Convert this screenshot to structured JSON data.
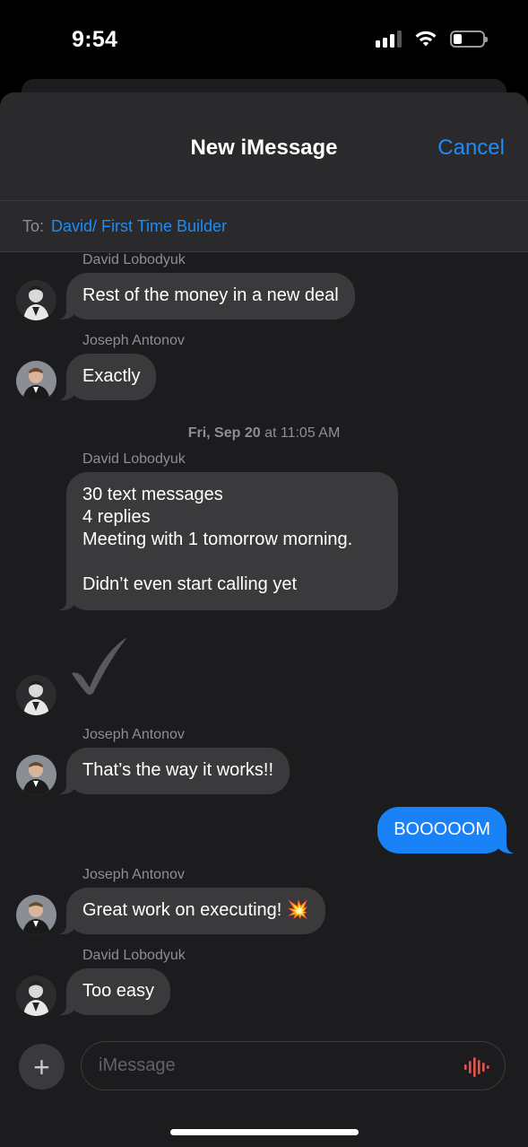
{
  "status_bar": {
    "time": "9:54"
  },
  "header": {
    "title": "New iMessage",
    "cancel_label": "Cancel"
  },
  "to": {
    "label": "To:",
    "value": "David/ First Time Builder"
  },
  "messages": [
    {
      "sender": "David Lobodyuk",
      "text": "Rest of the money in a new deal"
    },
    {
      "sender": "Joseph Antonov",
      "text": "Exactly"
    },
    {
      "timestamp_day": "Fri, Sep 20",
      "timestamp_time": " at 11:05 AM"
    },
    {
      "sender": "David Lobodyuk",
      "text": "30 text messages\n4 replies\nMeeting with 1 tomorrow morning.\n\nDidn’t even start calling yet"
    },
    {
      "sender": "David Lobodyuk",
      "sticker": "checkmark-sticker"
    },
    {
      "sender": "Joseph Antonov",
      "text": "That’s the way it works!!"
    },
    {
      "sender": "Me",
      "text": "BOOOOOM"
    },
    {
      "sender": "Joseph Antonov",
      "text": "Great work on executing! 💥"
    },
    {
      "sender": "David Lobodyuk",
      "text": "Too easy"
    }
  ],
  "compose": {
    "placeholder": "iMessage"
  },
  "colors": {
    "accent": "#1c8cf9",
    "outgoing_bubble": "#1a82f7",
    "incoming_bubble": "#3a3a3c",
    "background": "#1c1c1e"
  },
  "icons": [
    "signal-icon",
    "wifi-icon",
    "battery-icon",
    "plus-icon",
    "audio-waveform-icon"
  ]
}
